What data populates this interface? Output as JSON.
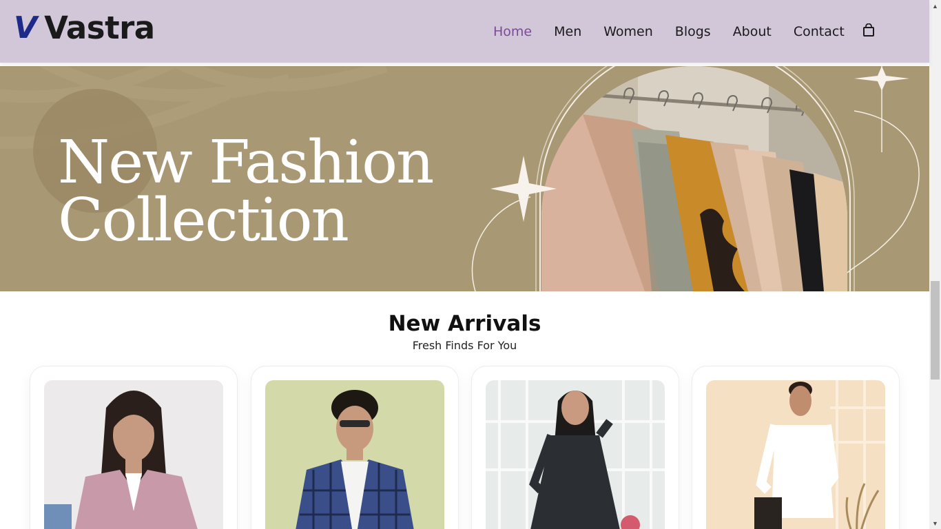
{
  "brand": {
    "mark": "V",
    "name": "Vastra",
    "mark_color": "#1e2a8a"
  },
  "nav": {
    "items": [
      {
        "label": "Home",
        "active": true
      },
      {
        "label": "Men",
        "active": false
      },
      {
        "label": "Women",
        "active": false
      },
      {
        "label": "Blogs",
        "active": false
      },
      {
        "label": "About",
        "active": false
      },
      {
        "label": "Contact",
        "active": false
      }
    ],
    "cart_icon": "shopping-bag-icon",
    "active_color": "#7a4c98"
  },
  "banner": {
    "line1": "New Fashion",
    "line2": "Collection",
    "bg_color": "#a99874"
  },
  "new_arrivals": {
    "title": "New Arrivals",
    "subtitle": "Fresh Finds For You",
    "products": [
      {
        "image": "woman-pink-denim-jacket"
      },
      {
        "image": "man-plaid-shirt-sunglasses"
      },
      {
        "image": "woman-black-floral-dress"
      },
      {
        "image": "man-white-kurta"
      }
    ]
  },
  "colors": {
    "header_bg": "#d2c7d8",
    "text": "#1a1a1a"
  }
}
